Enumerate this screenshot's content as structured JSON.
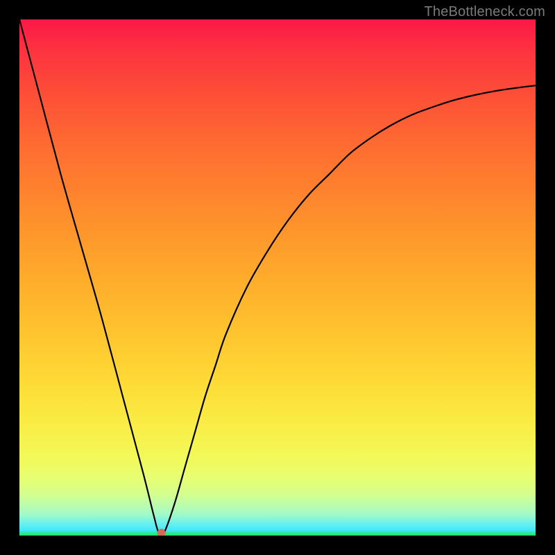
{
  "site_watermark": "TheBottleneck.com",
  "chart_data": {
    "type": "line",
    "title": "",
    "xlabel": "",
    "ylabel": "",
    "xlim": [
      0,
      100
    ],
    "ylim": [
      0,
      100
    ],
    "minimum_x": 27,
    "marker": {
      "x": 27.5,
      "y": 0.5,
      "color": "#d46a52",
      "radius_px": 6
    },
    "series": [
      {
        "name": "curve",
        "x": [
          0,
          4,
          8,
          12,
          16,
          20,
          24,
          26,
          27,
          28,
          30,
          32,
          34,
          36,
          38,
          40,
          44,
          48,
          52,
          56,
          60,
          64,
          68,
          72,
          76,
          80,
          84,
          88,
          92,
          96,
          100
        ],
        "values": [
          100,
          85,
          70,
          56,
          42,
          27,
          12,
          4,
          0.5,
          0.5,
          6,
          13,
          20,
          27,
          33,
          39,
          48,
          55,
          61,
          66,
          70,
          74,
          77,
          79.5,
          81.5,
          83,
          84.3,
          85.3,
          86.1,
          86.7,
          87.2
        ]
      }
    ],
    "background_gradient": {
      "top": "#fc1847",
      "middle": "#fec52e",
      "bottom": "#21e56b"
    }
  }
}
